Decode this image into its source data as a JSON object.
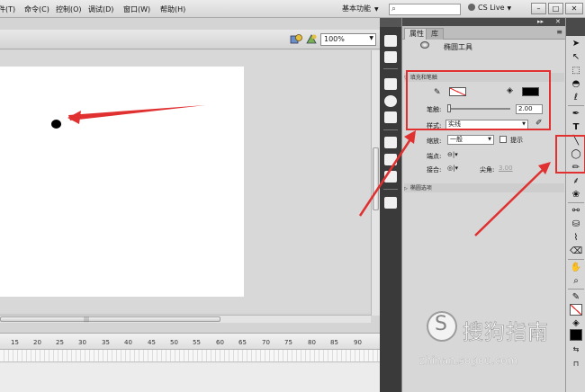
{
  "colors": {
    "annotation_red": "#e03030",
    "stage_bg": "#ffffff",
    "dock_dark": "#3a3a3a",
    "panel_bg": "#d7d7d7"
  },
  "menubar": {
    "items": [
      "件(T)",
      "命令(C)",
      "控制(O)",
      "调试(D)",
      "窗口(W)",
      "帮助(H)"
    ],
    "workspace": "基本功能",
    "search_placeholder": "",
    "cslive": "CS Live",
    "window_controls": {
      "minimize": "–",
      "restore": "□",
      "close": "✕"
    }
  },
  "editbar": {
    "zoom": "100%",
    "icons": [
      "edit-symbols-icon",
      "edit-scene-icon"
    ]
  },
  "properties": {
    "tabs": [
      "属性",
      "库"
    ],
    "tool_name": "椭圆工具",
    "sections": {
      "fill_stroke": "填充和笔触",
      "oval_options": "椭圆选项"
    },
    "stroke_label": "笔触:",
    "stroke_value": "2.00",
    "style_label": "样式:",
    "style_value": "实线",
    "scale_label": "缩放:",
    "scale_value": "一般",
    "hint_label": "提示",
    "cap_label": "端点:",
    "join_label": "接合:",
    "miter_label": "尖角:",
    "miter_value": "3.00"
  },
  "timeline": {
    "frame_numbers": [
      "15",
      "20",
      "25",
      "30",
      "35",
      "40",
      "45",
      "50",
      "55",
      "60",
      "65",
      "70",
      "75",
      "80",
      "85",
      "90"
    ]
  },
  "watermark": {
    "title": "搜狗指南",
    "url": "zhinan.sogou.com"
  },
  "toolbar": {
    "tools": [
      "selection-tool",
      "subselection-tool",
      "free-transform-tool",
      "3d-rotation-tool",
      "lasso-tool",
      "pen-tool",
      "text-tool",
      "line-tool",
      "oval-tool",
      "pencil-tool",
      "brush-tool",
      "deco-tool",
      "bone-tool",
      "paint-bucket-tool",
      "eyedropper-tool",
      "eraser-tool",
      "hand-tool",
      "zoom-tool",
      "stroke-color",
      "fill-color"
    ]
  }
}
